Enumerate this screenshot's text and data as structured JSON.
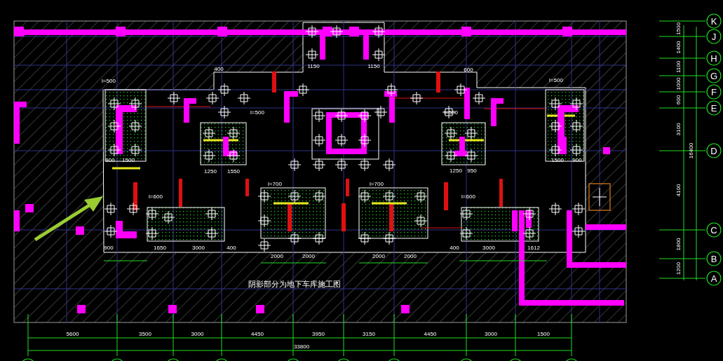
{
  "drawing_title": "阴影部分为地下车库施工图",
  "axis_rows": [
    {
      "label": "K"
    },
    {
      "label": "J"
    },
    {
      "label": "H"
    },
    {
      "label": "G"
    },
    {
      "label": "F"
    },
    {
      "label": "E"
    },
    {
      "label": "D"
    },
    {
      "label": "C"
    },
    {
      "label": "B"
    },
    {
      "label": "A"
    }
  ],
  "row_dimensions": [
    "1500",
    "1400",
    "1100",
    "1000",
    "600",
    "3100",
    "4100",
    "1800",
    "1200"
  ],
  "row_total": "16400",
  "column_dimensions": [
    "5600",
    "3500",
    "3000",
    "4450",
    "3950",
    "3150",
    "4450",
    "3000",
    "1500"
  ],
  "column_total": "33800",
  "plan_labels": [
    "l=500",
    "l=500",
    "l=500",
    "l=500",
    "900",
    "1500",
    "1250",
    "1550",
    "1250",
    "950",
    "1500",
    "900",
    "400",
    "600",
    "1150",
    "1150",
    "l=700",
    "l=700",
    "l=600",
    "l=600",
    "900",
    "1650",
    "3000",
    "400",
    "2000",
    "2000",
    "2000",
    "2000",
    "400",
    "3000",
    "1612"
  ]
}
